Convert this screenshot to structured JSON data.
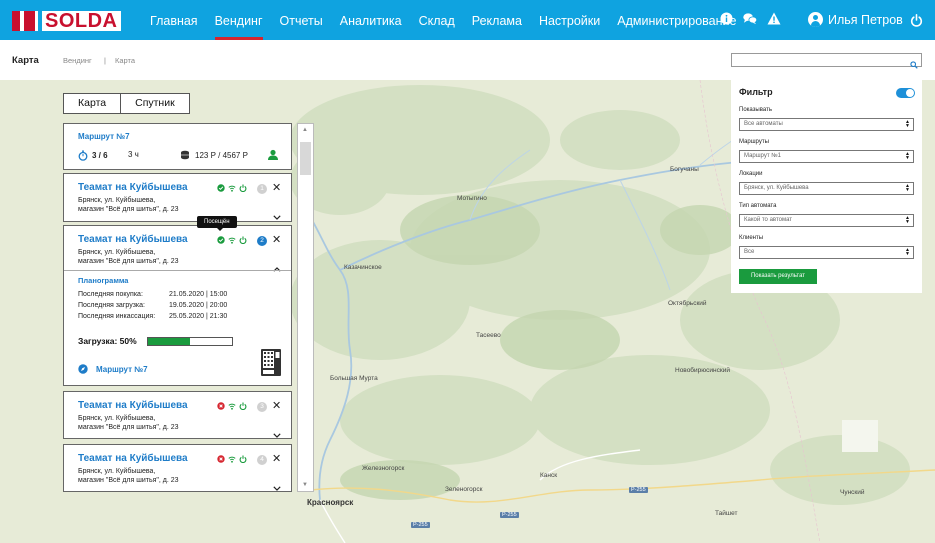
{
  "brand": {
    "name": "SOLDA",
    "color": "#c8102e"
  },
  "nav": {
    "items": [
      {
        "label": "Главная"
      },
      {
        "label": "Вендинг"
      },
      {
        "label": "Отчеты"
      },
      {
        "label": "Аналитика"
      },
      {
        "label": "Склад"
      },
      {
        "label": "Реклама"
      },
      {
        "label": "Настройки"
      },
      {
        "label": "Администрирование"
      }
    ],
    "active": "Вендинг"
  },
  "header_icons": [
    "info-icon",
    "chat-icon",
    "warning-icon"
  ],
  "user": {
    "name": "Илья Петров"
  },
  "breadcrumb": {
    "title": "Карта",
    "items": [
      "Вендинг",
      "|",
      "Карта"
    ]
  },
  "search": {
    "placeholder": ""
  },
  "map": {
    "type_buttons": [
      "Карта",
      "Спутник"
    ],
    "places": [
      "Мотыгино",
      "Богучаны",
      "Казачинское",
      "Тасеево",
      "Октябрьский",
      "Новобирюсинский",
      "Большая Мурта",
      "Железногорск",
      "Зеленогорск",
      "Канск",
      "Чунский",
      "Тайшет",
      "Красноярск"
    ],
    "roads": [
      "Р-255",
      "Р-255",
      "Р-255"
    ]
  },
  "route": {
    "title": "Маршрут №7",
    "progress": "3 / 6",
    "duration": "3 ч",
    "money": "123 Р / 4567 Р"
  },
  "machines": [
    {
      "title": "Теамат на Куйбышева",
      "address_line1": "Брянск, ул. Куйбышева,",
      "address_line2": "магазин \"Всё для шитья\", д. 23",
      "number": "1",
      "status": "ok"
    },
    {
      "title": "Теамат на Куйбышева",
      "address_line1": "Брянск, ул. Куйбышева,",
      "address_line2": "магазин \"Всё для шитья\", д. 23",
      "number": "2",
      "status": "ok"
    },
    {
      "title": "Теамат на Куйбышева",
      "address_line1": "Брянск, ул. Куйбышева,",
      "address_line2": "магазин \"Всё для шитья\", д. 23",
      "number": "3",
      "status": "error"
    },
    {
      "title": "Теамат на Куйбышева",
      "address_line1": "Брянск, ул. Куйбышева,",
      "address_line2": "магазин \"Всё для шитья\", д. 23",
      "number": "4",
      "status": "error"
    }
  ],
  "tooltip": "Посещён",
  "details": {
    "section_title": "Планограмма",
    "rows": [
      {
        "label": "Последняя покупка:",
        "value": "21.05.2020 | 15:00"
      },
      {
        "label": "Последняя загрузка:",
        "value": "19.05.2020 | 20:00"
      },
      {
        "label": "Последняя инкассация:",
        "value": "25.05.2020 | 21:30"
      }
    ],
    "load_label": "Загрузка: 50%",
    "load_fraction": 0.5,
    "route_link": "Маршрут №7"
  },
  "filter": {
    "title": "Фильтр",
    "enabled": true,
    "fields": [
      {
        "label": "Показывать",
        "value": "Все автоматы"
      },
      {
        "label": "Маршруты",
        "value": "Маршрут №1"
      },
      {
        "label": "Локации",
        "value": "Брянск, ул. Куйбышева"
      },
      {
        "label": "Тип автомата",
        "value": "Какой то автомат"
      },
      {
        "label": "Клиенты",
        "value": "Все"
      }
    ],
    "submit_label": "Показать результат"
  },
  "colors": {
    "topbar": "#0fa3e0",
    "link": "#1e7cc8",
    "ok": "#1a9b3e",
    "error": "#d6252f"
  }
}
